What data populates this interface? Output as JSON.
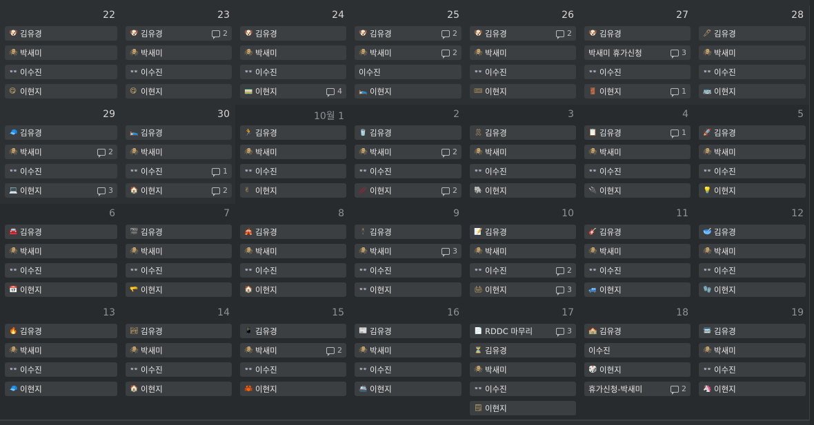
{
  "weeks": [
    {
      "days": [
        {
          "num": "22",
          "dim": false,
          "cards": [
            {
              "icon": "🐶",
              "title": "김유경",
              "count": ""
            },
            {
              "icon": "🕷",
              "title": "박새미",
              "count": ""
            },
            {
              "icon": "👓",
              "title": "이수진",
              "count": ""
            },
            {
              "icon": "😋",
              "title": "이현지",
              "count": ""
            }
          ]
        },
        {
          "num": "23",
          "dim": false,
          "cards": [
            {
              "icon": "🐶",
              "title": "김유경",
              "count": "2"
            },
            {
              "icon": "🕷",
              "title": "박새미",
              "count": ""
            },
            {
              "icon": "👓",
              "title": "이수진",
              "count": ""
            },
            {
              "icon": "😋",
              "title": "이현지",
              "count": ""
            }
          ]
        },
        {
          "num": "24",
          "dim": false,
          "cards": [
            {
              "icon": "🐶",
              "title": "김유경",
              "count": ""
            },
            {
              "icon": "🕷",
              "title": "박새미",
              "count": ""
            },
            {
              "icon": "👓",
              "title": "이수진",
              "count": ""
            },
            {
              "icon": "🚃",
              "title": "이현지",
              "count": "4"
            }
          ]
        },
        {
          "num": "25",
          "dim": false,
          "cards": [
            {
              "icon": "🐶",
              "title": "김유경",
              "count": "2"
            },
            {
              "icon": "🕷",
              "title": "박새미",
              "count": "2"
            },
            {
              "icon": "",
              "title": "이수진",
              "count": ""
            },
            {
              "icon": "🛌",
              "title": "이현지",
              "count": ""
            }
          ]
        },
        {
          "num": "26",
          "dim": false,
          "cards": [
            {
              "icon": "🐶",
              "title": "김유경",
              "count": "2"
            },
            {
              "icon": "🕷",
              "title": "박새미",
              "count": ""
            },
            {
              "icon": "👓",
              "title": "이수진",
              "count": ""
            },
            {
              "icon": "🎟",
              "title": "이현지",
              "count": ""
            }
          ]
        },
        {
          "num": "27",
          "dim": false,
          "cards": [
            {
              "icon": "🐶",
              "title": "김유경",
              "count": ""
            },
            {
              "icon": "",
              "title": "박새미 휴가신청",
              "count": "3"
            },
            {
              "icon": "👓",
              "title": "이수진",
              "count": ""
            },
            {
              "icon": "🚪",
              "title": "이현지",
              "count": "1"
            }
          ]
        },
        {
          "num": "28",
          "dim": false,
          "cards": [
            {
              "icon": "🖊",
              "title": "김유경",
              "count": ""
            },
            {
              "icon": "🕷",
              "title": "박새미",
              "count": ""
            },
            {
              "icon": "👓",
              "title": "이수진",
              "count": ""
            },
            {
              "icon": "🚌",
              "title": "이현지",
              "count": ""
            }
          ]
        }
      ]
    },
    {
      "days": [
        {
          "num": "29",
          "dim": false,
          "cards": [
            {
              "icon": "🧢",
              "title": "김유경",
              "count": ""
            },
            {
              "icon": "🕷",
              "title": "박새미",
              "count": "2"
            },
            {
              "icon": "👓",
              "title": "이수진",
              "count": ""
            },
            {
              "icon": "💻",
              "title": "이현지",
              "count": "3"
            }
          ]
        },
        {
          "num": "30",
          "dim": false,
          "cards": [
            {
              "icon": "🛌",
              "title": "김유경",
              "count": ""
            },
            {
              "icon": "🕷",
              "title": "박새미",
              "count": ""
            },
            {
              "icon": "👓",
              "title": "이수진",
              "count": "1"
            },
            {
              "icon": "🏠",
              "title": "이현지",
              "count": "2"
            }
          ]
        },
        {
          "num": "10월 1",
          "dim": true,
          "cards": [
            {
              "icon": "🏃",
              "title": "김유경",
              "count": ""
            },
            {
              "icon": "🕷",
              "title": "박새미",
              "count": ""
            },
            {
              "icon": "👓",
              "title": "이수진",
              "count": ""
            },
            {
              "icon": "✌",
              "title": "이현지",
              "count": ""
            }
          ]
        },
        {
          "num": "2",
          "dim": true,
          "cards": [
            {
              "icon": "🥤",
              "title": "김유경",
              "count": ""
            },
            {
              "icon": "🕷",
              "title": "박새미",
              "count": "2"
            },
            {
              "icon": "👓",
              "title": "이수진",
              "count": ""
            },
            {
              "icon": "🥢",
              "title": "이현지",
              "count": "2"
            }
          ]
        },
        {
          "num": "3",
          "dim": true,
          "cards": [
            {
              "icon": "🎗",
              "title": "김유경",
              "count": ""
            },
            {
              "icon": "🕷",
              "title": "박새미",
              "count": ""
            },
            {
              "icon": "👓",
              "title": "이수진",
              "count": ""
            },
            {
              "icon": "🐘",
              "title": "이현지",
              "count": ""
            }
          ]
        },
        {
          "num": "4",
          "dim": true,
          "cards": [
            {
              "icon": "📋",
              "title": "김유경",
              "count": "1"
            },
            {
              "icon": "🕷",
              "title": "박새미",
              "count": ""
            },
            {
              "icon": "👓",
              "title": "이수진",
              "count": ""
            },
            {
              "icon": "🔌",
              "title": "이현지",
              "count": ""
            }
          ]
        },
        {
          "num": "5",
          "dim": true,
          "cards": [
            {
              "icon": "🚀",
              "title": "김유경",
              "count": ""
            },
            {
              "icon": "🕷",
              "title": "박새미",
              "count": ""
            },
            {
              "icon": "👓",
              "title": "이수진",
              "count": ""
            },
            {
              "icon": "💡",
              "title": "이현지",
              "count": ""
            }
          ]
        }
      ]
    },
    {
      "days": [
        {
          "num": "6",
          "dim": true,
          "cards": [
            {
              "icon": "🚘",
              "title": "김유경",
              "count": ""
            },
            {
              "icon": "🕷",
              "title": "박새미",
              "count": ""
            },
            {
              "icon": "👓",
              "title": "이수진",
              "count": ""
            },
            {
              "icon": "📅",
              "title": "이현지",
              "count": ""
            }
          ]
        },
        {
          "num": "7",
          "dim": true,
          "cards": [
            {
              "icon": "🎬",
              "title": "김유경",
              "count": ""
            },
            {
              "icon": "🕷",
              "title": "박새미",
              "count": ""
            },
            {
              "icon": "👓",
              "title": "이수진",
              "count": ""
            },
            {
              "icon": "🫳",
              "title": "이현지",
              "count": ""
            }
          ]
        },
        {
          "num": "8",
          "dim": true,
          "cards": [
            {
              "icon": "🎪",
              "title": "김유경",
              "count": ""
            },
            {
              "icon": "🕷",
              "title": "박새미",
              "count": ""
            },
            {
              "icon": "👓",
              "title": "이수진",
              "count": ""
            },
            {
              "icon": "🏠",
              "title": "이현지",
              "count": ""
            }
          ]
        },
        {
          "num": "9",
          "dim": true,
          "cards": [
            {
              "icon": "🕴",
              "title": "김유경",
              "count": ""
            },
            {
              "icon": "🕷",
              "title": "박새미",
              "count": "3"
            },
            {
              "icon": "👓",
              "title": "이수진",
              "count": ""
            },
            {
              "icon": "👓",
              "title": "이현지",
              "count": ""
            }
          ]
        },
        {
          "num": "10",
          "dim": true,
          "cards": [
            {
              "icon": "📝",
              "title": "김유경",
              "count": ""
            },
            {
              "icon": "🕷",
              "title": "박새미",
              "count": ""
            },
            {
              "icon": "👓",
              "title": "이수진",
              "count": "2"
            },
            {
              "icon": "🖨",
              "title": "이현지",
              "count": "3"
            }
          ]
        },
        {
          "num": "11",
          "dim": true,
          "cards": [
            {
              "icon": "🎸",
              "title": "김유경",
              "count": ""
            },
            {
              "icon": "🕷",
              "title": "박새미",
              "count": ""
            },
            {
              "icon": "👓",
              "title": "이수진",
              "count": ""
            },
            {
              "icon": "🚙",
              "title": "이현지",
              "count": ""
            }
          ]
        },
        {
          "num": "12",
          "dim": true,
          "cards": [
            {
              "icon": "🥣",
              "title": "김유경",
              "count": ""
            },
            {
              "icon": "🕷",
              "title": "박새미",
              "count": ""
            },
            {
              "icon": "👓",
              "title": "이수진",
              "count": ""
            },
            {
              "icon": "🧤",
              "title": "이현지",
              "count": ""
            }
          ]
        }
      ]
    },
    {
      "days": [
        {
          "num": "13",
          "dim": true,
          "cards": [
            {
              "icon": "🔥",
              "title": "김유경",
              "count": ""
            },
            {
              "icon": "🕷",
              "title": "박새미",
              "count": ""
            },
            {
              "icon": "👓",
              "title": "이수진",
              "count": ""
            },
            {
              "icon": "🧢",
              "title": "이현지",
              "count": ""
            }
          ]
        },
        {
          "num": "14",
          "dim": true,
          "cards": [
            {
              "icon": "🏞",
              "title": "김유경",
              "count": ""
            },
            {
              "icon": "🕷",
              "title": "박새미",
              "count": ""
            },
            {
              "icon": "👓",
              "title": "이수진",
              "count": ""
            },
            {
              "icon": "🏠",
              "title": "이현지",
              "count": ""
            }
          ]
        },
        {
          "num": "15",
          "dim": true,
          "cards": [
            {
              "icon": "📱",
              "title": "김유경",
              "count": ""
            },
            {
              "icon": "🕷",
              "title": "박새미",
              "count": "2"
            },
            {
              "icon": "👓",
              "title": "이수진",
              "count": ""
            },
            {
              "icon": "🦀",
              "title": "이현지",
              "count": ""
            }
          ]
        },
        {
          "num": "16",
          "dim": true,
          "cards": [
            {
              "icon": "📰",
              "title": "김유경",
              "count": ""
            },
            {
              "icon": "🕷",
              "title": "박새미",
              "count": ""
            },
            {
              "icon": "👓",
              "title": "이수진",
              "count": ""
            },
            {
              "icon": "🚢",
              "title": "이현지",
              "count": ""
            }
          ]
        },
        {
          "num": "17",
          "dim": true,
          "cards": [
            {
              "icon": "📄",
              "title": "RDDC 마무리",
              "count": "3"
            },
            {
              "icon": "⏳",
              "title": "김유경",
              "count": ""
            },
            {
              "icon": "🕷",
              "title": "박새미",
              "count": ""
            },
            {
              "icon": "👓",
              "title": "이수진",
              "count": ""
            },
            {
              "icon": "🗒",
              "title": "이현지",
              "count": ""
            }
          ]
        },
        {
          "num": "18",
          "dim": true,
          "cards": [
            {
              "icon": "🏫",
              "title": "김유경",
              "count": ""
            },
            {
              "icon": "",
              "title": "이수진",
              "count": ""
            },
            {
              "icon": "🎲",
              "title": "이현지",
              "count": ""
            },
            {
              "icon": "",
              "title": "휴가신청-박새미",
              "count": "2"
            }
          ]
        },
        {
          "num": "19",
          "dim": true,
          "cards": [
            {
              "icon": "🚍",
              "title": "김유경",
              "count": ""
            },
            {
              "icon": "🕷",
              "title": "박새미",
              "count": ""
            },
            {
              "icon": "👓",
              "title": "이수진",
              "count": ""
            },
            {
              "icon": "🦄",
              "title": "이현지",
              "count": ""
            }
          ]
        }
      ]
    }
  ]
}
